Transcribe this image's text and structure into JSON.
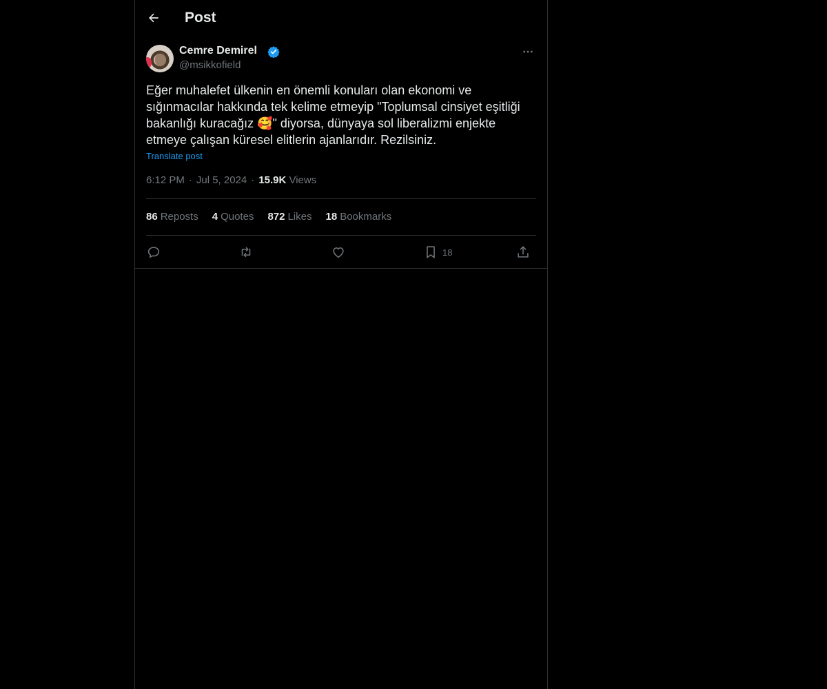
{
  "header": {
    "title": "Post",
    "back_icon": "arrow-left-icon"
  },
  "author": {
    "display_name": "Cemre Demirel",
    "handle": "@msikkofield",
    "verified_color": "#1d9bf0"
  },
  "post": {
    "text_before_emoji": "Eğer muhalefet ülkenin en önemli konuları olan ekonomi ve sığınmacılar hakkında tek kelime etmeyip \"Toplumsal cinsiyet eşitliği bakanlığı kuracağız ",
    "emoji": "🥰",
    "text_after_emoji": "\" diyorsa, dünyaya sol liberalizmi enjekte etmeye çalışan küresel elitlerin ajanlarıdır. Rezilsiniz.",
    "translate_label": "Translate post",
    "time": "6:12 PM",
    "date": "Jul 5, 2024",
    "views_count": "15.9K",
    "views_label": "Views"
  },
  "stats": {
    "reposts_count": "86",
    "reposts_label": "Reposts",
    "quotes_count": "4",
    "quotes_label": "Quotes",
    "likes_count": "872",
    "likes_label": "Likes",
    "bookmarks_count": "18",
    "bookmarks_label": "Bookmarks"
  },
  "actions": {
    "reply_icon": "reply-icon",
    "repost_icon": "repost-icon",
    "like_icon": "heart-icon",
    "bookmark_icon": "bookmark-icon",
    "bookmark_count": "18",
    "share_icon": "share-icon"
  },
  "colors": {
    "background": "#000000",
    "text": "#e7e9ea",
    "muted": "#71767b",
    "link": "#1d9bf0",
    "border": "#2f3336"
  }
}
